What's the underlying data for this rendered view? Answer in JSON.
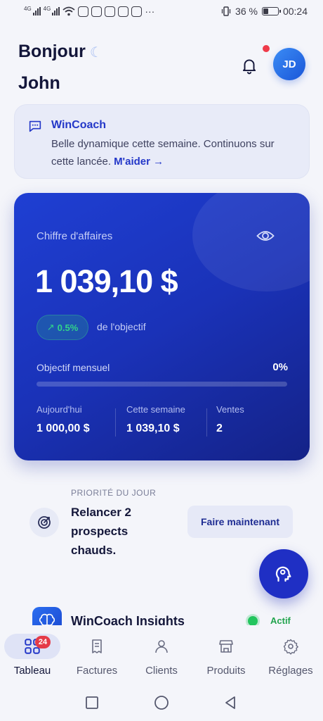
{
  "status_bar": {
    "battery": "36 %",
    "time": "00:24",
    "more": "···",
    "sim_tag": "4G"
  },
  "header": {
    "greeting_line1": "Bonjour",
    "greeting_line2": "John",
    "avatar_initials": "JD"
  },
  "coach": {
    "title": "WinCoach",
    "message": "Belle dynamique cette semaine. Continuons sur cette lancée.",
    "link": "M'aider →"
  },
  "revenue": {
    "label": "Chiffre d'affaires",
    "amount": "1 039,10 $",
    "trend": "0.5%",
    "trend_suffix": "de l'objectif",
    "objective_label": "Objectif mensuel",
    "objective_percent": "0%",
    "objective_progress": 0,
    "stats": [
      {
        "label": "Aujourd'hui",
        "value": "1 000,00 $"
      },
      {
        "label": "Cette semaine",
        "value": "1 039,10 $"
      },
      {
        "label": "Ventes",
        "value": "2"
      }
    ]
  },
  "priority": {
    "label": "PRIORITÉ DU JOUR",
    "text": "Relancer 2 prospects chauds.",
    "cta": "Faire maintenant"
  },
  "insights": {
    "title": "WinCoach Insights",
    "status": "Actif"
  },
  "tabs": [
    {
      "label": "Tableau",
      "badge": "24",
      "icon": "grid-icon"
    },
    {
      "label": "Factures",
      "icon": "invoice-icon"
    },
    {
      "label": "Clients",
      "icon": "user-icon"
    },
    {
      "label": "Produits",
      "icon": "store-icon"
    },
    {
      "label": "Réglages",
      "icon": "gear-icon"
    }
  ],
  "colors": {
    "primary": "#1f2fc4",
    "accent_green": "#23c55e",
    "badge_red": "#e53b48"
  }
}
